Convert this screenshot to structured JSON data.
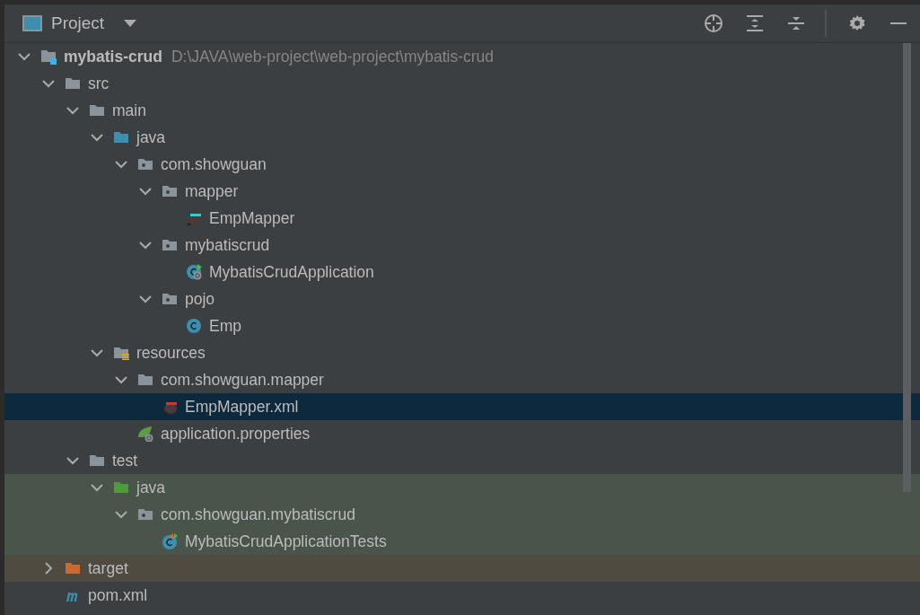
{
  "panel": {
    "title": "Project"
  },
  "tree": [
    {
      "label": "mybatis-crud",
      "path": "D:\\JAVA\\web-project\\web-project\\mybatis-crud",
      "kind": "module",
      "expanded": true,
      "selected": false,
      "children": [
        {
          "label": "src",
          "kind": "folder",
          "expanded": true,
          "selected": false,
          "children": [
            {
              "label": "main",
              "kind": "folder",
              "expanded": true,
              "selected": false,
              "children": [
                {
                  "label": "java",
                  "kind": "source-folder",
                  "expanded": true,
                  "selected": false,
                  "children": [
                    {
                      "label": "com.showguan",
                      "kind": "package",
                      "expanded": true,
                      "selected": false,
                      "children": [
                        {
                          "label": "mapper",
                          "kind": "package",
                          "expanded": true,
                          "selected": false,
                          "children": [
                            {
                              "label": "EmpMapper",
                              "kind": "mapper",
                              "selected": false
                            }
                          ]
                        },
                        {
                          "label": "mybatiscrud",
                          "kind": "package",
                          "expanded": true,
                          "selected": false,
                          "children": [
                            {
                              "label": "MybatisCrudApplication",
                              "kind": "spring-class",
                              "selected": false
                            }
                          ]
                        },
                        {
                          "label": "pojo",
                          "kind": "package",
                          "expanded": true,
                          "selected": false,
                          "children": [
                            {
                              "label": "Emp",
                              "kind": "class",
                              "selected": false
                            }
                          ]
                        }
                      ]
                    }
                  ]
                },
                {
                  "label": "resources",
                  "kind": "resources-folder",
                  "expanded": true,
                  "selected": false,
                  "children": [
                    {
                      "label": "com.showguan.mapper",
                      "kind": "folder",
                      "expanded": true,
                      "selected": false,
                      "children": [
                        {
                          "label": "EmpMapper.xml",
                          "kind": "mapper-xml",
                          "selected": true
                        }
                      ]
                    },
                    {
                      "label": "application.properties",
                      "kind": "spring-properties",
                      "selected": false
                    }
                  ]
                }
              ]
            },
            {
              "label": "test",
              "kind": "folder",
              "expanded": true,
              "selected": false,
              "children": [
                {
                  "label": "java",
                  "kind": "test-folder",
                  "color": "#49544a",
                  "expanded": true,
                  "selected": false,
                  "children": [
                    {
                      "label": "com.showguan.mybatiscrud",
                      "kind": "package",
                      "color": "#49544a",
                      "expanded": true,
                      "selected": false,
                      "children": [
                        {
                          "label": "MybatisCrudApplicationTests",
                          "kind": "test-class",
                          "color": "#49544a",
                          "selected": false
                        }
                      ]
                    }
                  ]
                }
              ]
            }
          ]
        },
        {
          "label": "target",
          "kind": "excluded-folder",
          "color": "#4f4b41",
          "expanded": false,
          "selected": false
        },
        {
          "label": "pom.xml",
          "kind": "maven",
          "selected": false
        }
      ]
    }
  ]
}
